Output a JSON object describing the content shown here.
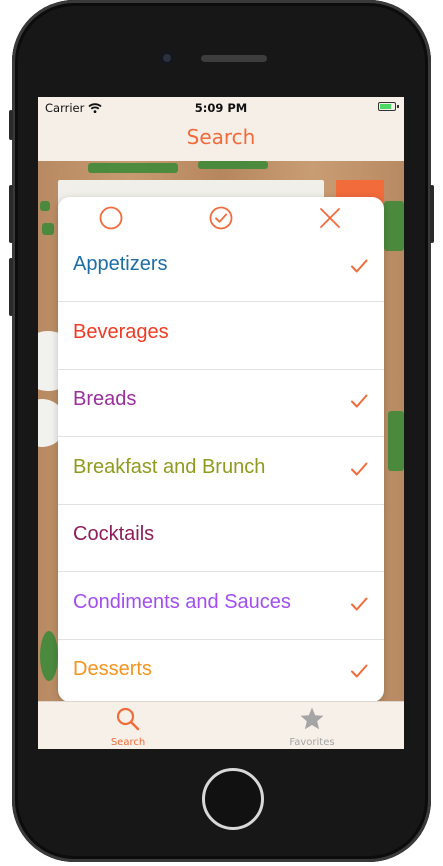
{
  "status_bar": {
    "carrier": "Carrier",
    "time": "5:09 PM"
  },
  "nav": {
    "title": "Search"
  },
  "popup": {
    "toolbar": {
      "select_none_icon": "circle-icon",
      "select_all_icon": "check-circle-icon",
      "close_icon": "close-icon"
    },
    "categories": [
      {
        "label": "Appetizers",
        "color": "#1c6ea4",
        "checked": true
      },
      {
        "label": "Beverages",
        "color": "#ef3b24",
        "checked": false
      },
      {
        "label": "Breads",
        "color": "#9b2f9d",
        "checked": true
      },
      {
        "label": "Breakfast and Brunch",
        "color": "#8f9b1f",
        "checked": true
      },
      {
        "label": "Cocktails",
        "color": "#8e1e5a",
        "checked": false
      },
      {
        "label": "Condiments and Sauces",
        "color": "#a34df0",
        "checked": true
      },
      {
        "label": "Desserts",
        "color": "#f7941d",
        "checked": true
      }
    ]
  },
  "tabbar": {
    "tabs": [
      {
        "label": "Search",
        "icon": "search-icon",
        "active": true,
        "color": "#f26b3a"
      },
      {
        "label": "Favorites",
        "icon": "star-icon",
        "active": false,
        "color": "#a5a5a5"
      }
    ]
  },
  "colors": {
    "accent": "#f26b3a"
  }
}
